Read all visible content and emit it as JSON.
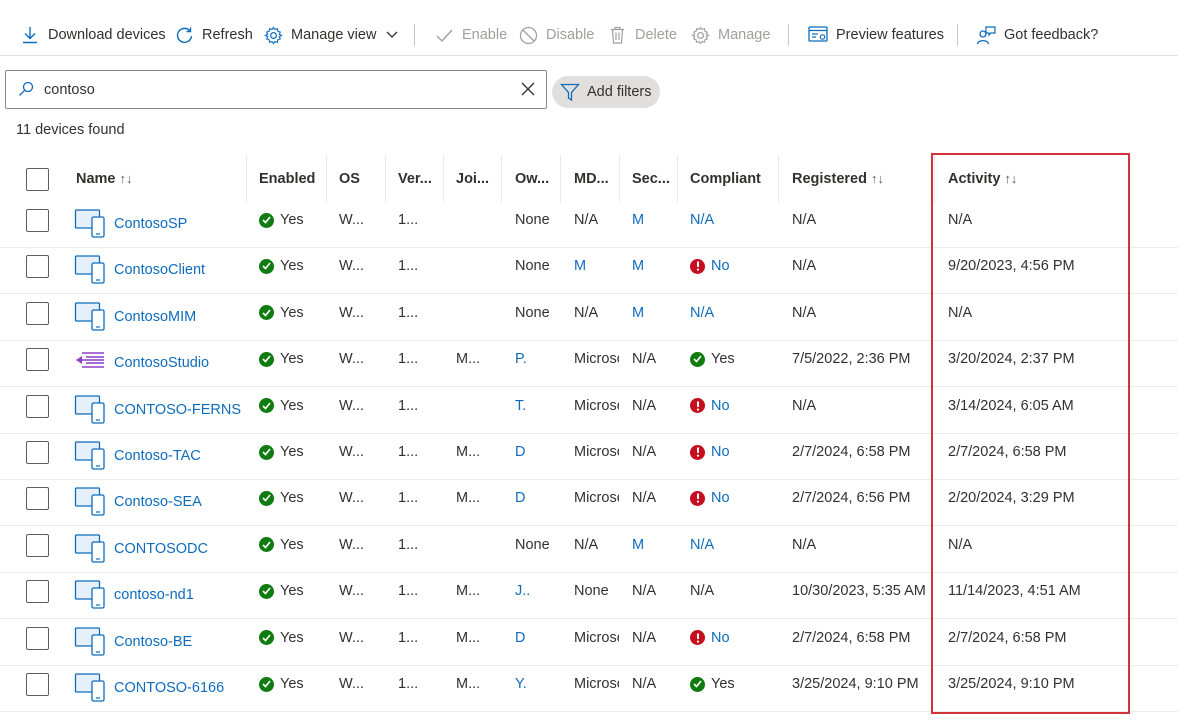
{
  "toolbar": {
    "download": "Download devices",
    "refresh": "Refresh",
    "manage_view": "Manage view",
    "enable": "Enable",
    "disable": "Disable",
    "delete": "Delete",
    "manage": "Manage",
    "preview": "Preview features",
    "feedback": "Got feedback?"
  },
  "search": {
    "value": "contoso",
    "filter_label": "Add filters"
  },
  "count": "11 devices found",
  "columns": {
    "name": "Name",
    "enabled": "Enabled",
    "os": "OS",
    "version": "Ver...",
    "join": "Joi...",
    "owner": "Ow...",
    "mdm": "MD...",
    "security": "Sec...",
    "compliant": "Compliant",
    "registered": "Registered",
    "activity": "Activity"
  },
  "colors": {
    "link": "#0f6cbd",
    "ok": "#107c10",
    "error": "#c50f1f",
    "highlight": "#d13438"
  },
  "rows": [
    {
      "icon": "tablet-icon",
      "name": "ContosoSP",
      "enabled": "Yes",
      "os": "W...",
      "version": "1...",
      "join": "",
      "owner": "None",
      "owner_link": false,
      "mdm": "N/A",
      "mdm_link": false,
      "sec": "M",
      "sec_link": true,
      "compliant": "N/A",
      "compliant_state": "link",
      "registered": "N/A",
      "activity": "N/A"
    },
    {
      "icon": "tablet-icon",
      "name": "ContosoClient",
      "enabled": "Yes",
      "os": "W...",
      "version": "1...",
      "join": "",
      "owner": "None",
      "owner_link": false,
      "mdm": "M",
      "mdm_link": true,
      "sec": "M",
      "sec_link": true,
      "compliant": "No",
      "compliant_state": "bad",
      "registered": "N/A",
      "activity": "9/20/2023, 4:56 PM"
    },
    {
      "icon": "tablet-icon",
      "name": "ContosoMIM",
      "enabled": "Yes",
      "os": "W...",
      "version": "1...",
      "join": "",
      "owner": "None",
      "owner_link": false,
      "mdm": "N/A",
      "mdm_link": false,
      "sec": "M",
      "sec_link": true,
      "compliant": "N/A",
      "compliant_state": "link",
      "registered": "N/A",
      "activity": "N/A"
    },
    {
      "icon": "studio-icon",
      "name": "ContosoStudio",
      "enabled": "Yes",
      "os": "W...",
      "version": "1...",
      "join": "M...",
      "owner": "P.",
      "owner_link": true,
      "mdm": "Microsc",
      "mdm_link": false,
      "sec": "N/A",
      "sec_link": false,
      "compliant": "Yes",
      "compliant_state": "ok",
      "registered": "7/5/2022, 2:36 PM",
      "activity": "3/20/2024, 2:37 PM"
    },
    {
      "icon": "tablet-icon",
      "name": "CONTOSO-FERNS",
      "enabled": "Yes",
      "os": "W...",
      "version": "1...",
      "join": "",
      "owner": "T.",
      "owner_link": true,
      "mdm": "Microsc",
      "mdm_link": false,
      "sec": "N/A",
      "sec_link": false,
      "compliant": "No",
      "compliant_state": "bad",
      "registered": "N/A",
      "activity": "3/14/2024, 6:05 AM"
    },
    {
      "icon": "tablet-icon",
      "name": "Contoso-TAC",
      "enabled": "Yes",
      "os": "W...",
      "version": "1...",
      "join": "M...",
      "owner": "D",
      "owner_link": true,
      "mdm": "Microsc",
      "mdm_link": false,
      "sec": "N/A",
      "sec_link": false,
      "compliant": "No",
      "compliant_state": "bad",
      "registered": "2/7/2024, 6:58 PM",
      "activity": "2/7/2024, 6:58 PM"
    },
    {
      "icon": "tablet-icon",
      "name": "Contoso-SEA",
      "enabled": "Yes",
      "os": "W...",
      "version": "1...",
      "join": "M...",
      "owner": "D",
      "owner_link": true,
      "mdm": "Microsc",
      "mdm_link": false,
      "sec": "N/A",
      "sec_link": false,
      "compliant": "No",
      "compliant_state": "bad",
      "registered": "2/7/2024, 6:56 PM",
      "activity": "2/20/2024, 3:29 PM"
    },
    {
      "icon": "tablet-icon",
      "name": "CONTOSODC",
      "enabled": "Yes",
      "os": "W...",
      "version": "1...",
      "join": "",
      "owner": "None",
      "owner_link": false,
      "mdm": "N/A",
      "mdm_link": false,
      "sec": "M",
      "sec_link": true,
      "compliant": "N/A",
      "compliant_state": "link",
      "registered": "N/A",
      "activity": "N/A"
    },
    {
      "icon": "tablet-icon",
      "name": "contoso-nd1",
      "enabled": "Yes",
      "os": "W...",
      "version": "1...",
      "join": "M...",
      "owner": "J..",
      "owner_link": true,
      "mdm": "None",
      "mdm_link": false,
      "sec": "N/A",
      "sec_link": false,
      "compliant": "N/A",
      "compliant_state": "plain",
      "registered": "10/30/2023, 5:35 AM",
      "activity": "11/14/2023, 4:51 AM"
    },
    {
      "icon": "tablet-icon",
      "name": "Contoso-BE",
      "enabled": "Yes",
      "os": "W...",
      "version": "1...",
      "join": "M...",
      "owner": "D",
      "owner_link": true,
      "mdm": "Microsc",
      "mdm_link": false,
      "sec": "N/A",
      "sec_link": false,
      "compliant": "No",
      "compliant_state": "bad",
      "registered": "2/7/2024, 6:58 PM",
      "activity": "2/7/2024, 6:58 PM"
    },
    {
      "icon": "tablet-icon",
      "name": "CONTOSO-6166",
      "enabled": "Yes",
      "os": "W...",
      "version": "1...",
      "join": "M...",
      "owner": "Y.",
      "owner_link": true,
      "mdm": "Microsc",
      "mdm_link": false,
      "sec": "N/A",
      "sec_link": false,
      "compliant": "Yes",
      "compliant_state": "ok",
      "registered": "3/25/2024, 9:10 PM",
      "activity": "3/25/2024, 9:10 PM"
    }
  ]
}
